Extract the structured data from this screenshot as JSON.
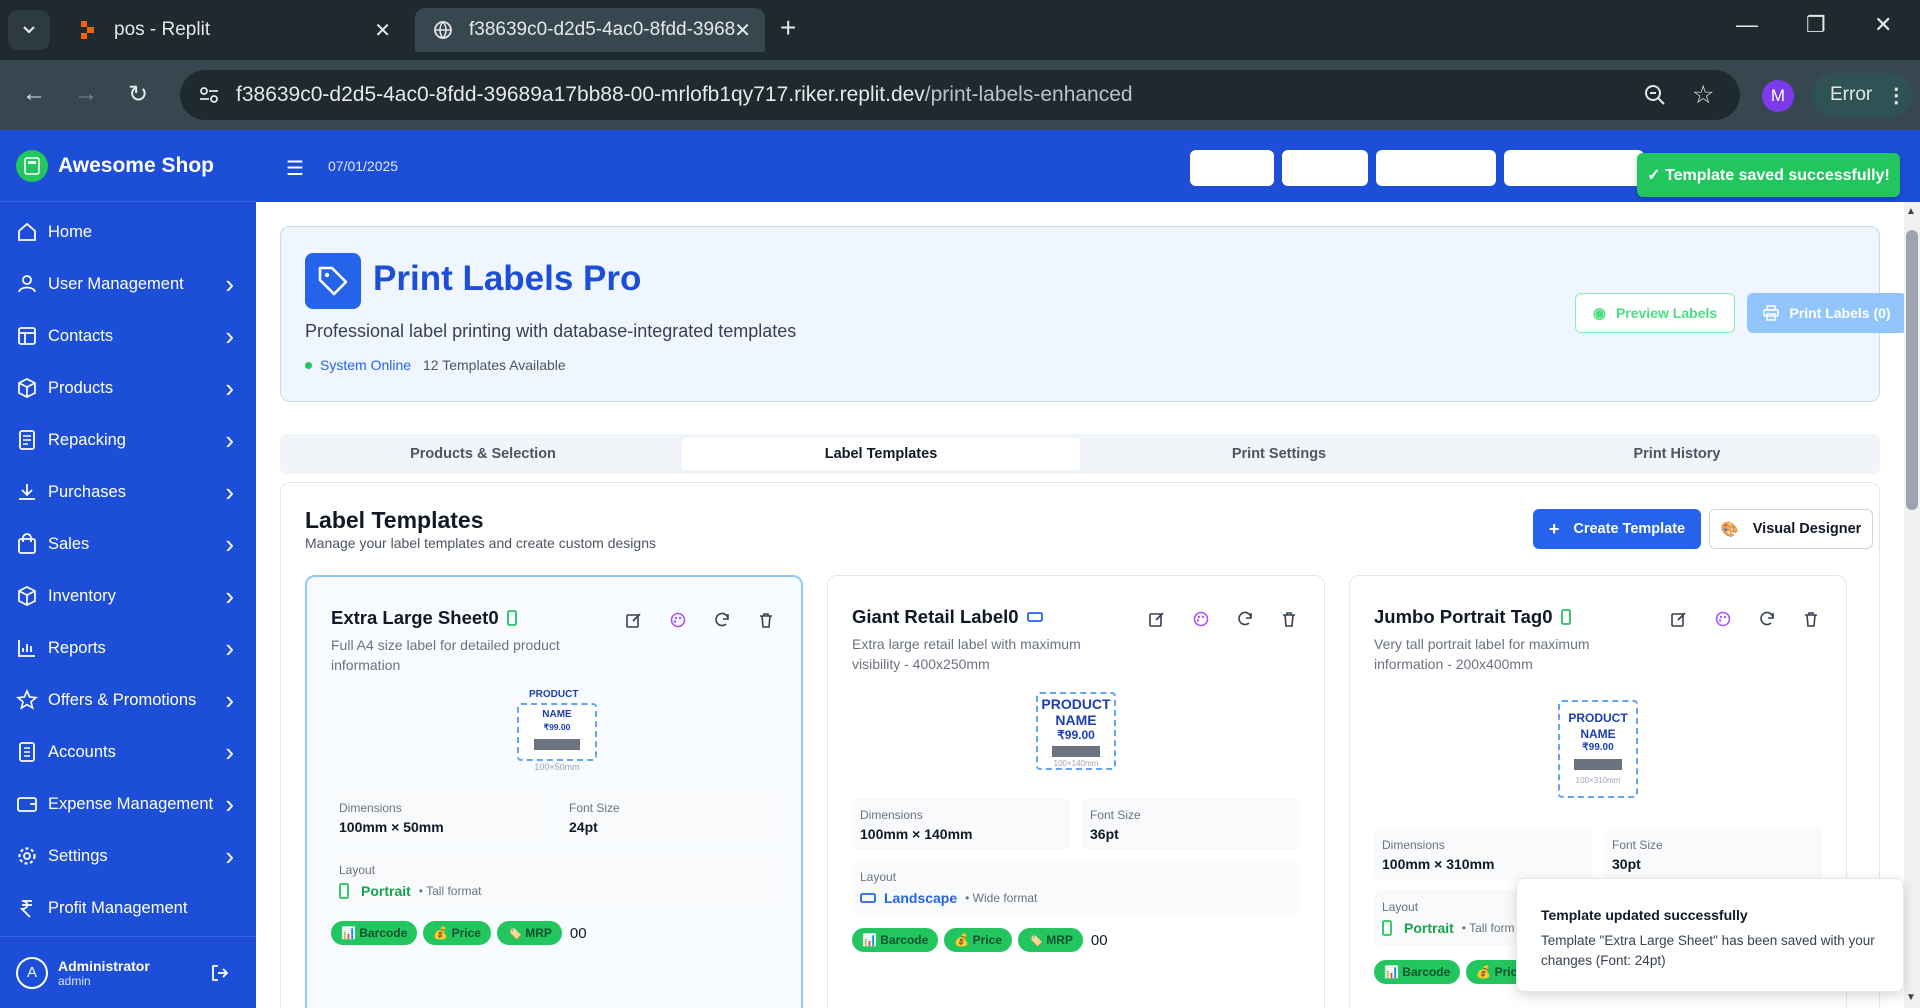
{
  "browser": {
    "tabs": [
      {
        "title": "pos - Replit"
      },
      {
        "title": "f38639c0-d2d5-4ac0-8fdd-3968"
      }
    ],
    "url_main": "f38639c0-d2d5-4ac0-8fdd-39689a17bb88-00-mrlofb1qy717.riker.replit.dev",
    "url_path": "/print-labels-enhanced",
    "profile_initial": "M",
    "error_label": "Error"
  },
  "app": {
    "brand": "Awesome Shop",
    "date": "07/01/2025",
    "toast_saved": "✓ Template saved successfully!"
  },
  "sidebar": {
    "items": [
      {
        "label": "Home",
        "icon": "home-icon",
        "chevron": false
      },
      {
        "label": "User Management",
        "icon": "user-icon",
        "chevron": true
      },
      {
        "label": "Contacts",
        "icon": "contacts-icon",
        "chevron": true
      },
      {
        "label": "Products",
        "icon": "box-icon",
        "chevron": true
      },
      {
        "label": "Repacking",
        "icon": "repack-icon",
        "chevron": true
      },
      {
        "label": "Purchases",
        "icon": "download-icon",
        "chevron": true
      },
      {
        "label": "Sales",
        "icon": "bag-icon",
        "chevron": true
      },
      {
        "label": "Inventory",
        "icon": "box-icon",
        "chevron": true
      },
      {
        "label": "Reports",
        "icon": "bar-chart-icon",
        "chevron": true
      },
      {
        "label": "Offers & Promotions",
        "icon": "star-icon",
        "chevron": true
      },
      {
        "label": "Accounts",
        "icon": "ledger-icon",
        "chevron": true
      },
      {
        "label": "Expense Management",
        "icon": "wallet-icon",
        "chevron": true
      },
      {
        "label": "Settings",
        "icon": "gear-icon",
        "chevron": true
      },
      {
        "label": "Profit Management",
        "icon": "rupee-icon",
        "chevron": false
      }
    ],
    "user": {
      "initial": "A",
      "name": "Administrator",
      "role": "admin"
    }
  },
  "hero": {
    "title": "Print Labels Pro",
    "subtitle": "Professional label printing with database-integrated templates",
    "status": "System Online",
    "templates_count": "12 Templates Available",
    "preview_button": "Preview Labels",
    "print_button": "Print Labels (0)"
  },
  "tabs": [
    "Products & Selection",
    "Label Templates",
    "Print Settings",
    "Print History"
  ],
  "active_tab": "Label Templates",
  "panel": {
    "title": "Label Templates",
    "subtitle": "Manage your label templates and create custom designs",
    "create_button": "Create Template",
    "visual_button": "Visual Designer"
  },
  "cards": [
    {
      "name": "Extra Large Sheet0",
      "description": "Full A4 size label for detailed product information",
      "preview": {
        "line1": "PRODUCT",
        "line2": "NAME",
        "price": "₹99.00",
        "size": "100×50mm"
      },
      "dimensions_label": "Dimensions",
      "dimensions": "100mm × 50mm",
      "font_label": "Font Size",
      "font": "24pt",
      "layout_label": "Layout",
      "layout": "Portrait",
      "layout_note": "• Tall format",
      "badges": [
        "📊 Barcode",
        "💰 Price",
        "🏷️ MRP"
      ],
      "suffix": "00"
    },
    {
      "name": "Giant Retail Label0",
      "description": "Extra large retail label with maximum visibility - 400x250mm",
      "preview": {
        "line1": "PRODUCT",
        "line2": "NAME",
        "price": "₹99.00",
        "size": "100×140mm"
      },
      "dimensions_label": "Dimensions",
      "dimensions": "100mm × 140mm",
      "font_label": "Font Size",
      "font": "36pt",
      "layout_label": "Layout",
      "layout": "Landscape",
      "layout_note": "• Wide format",
      "badges": [
        "📊 Barcode",
        "💰 Price",
        "🏷️ MRP"
      ],
      "suffix": "00"
    },
    {
      "name": "Jumbo Portrait Tag0",
      "description": "Very tall portrait label for maximum information - 200x400mm",
      "preview": {
        "line1": "PRODUCT",
        "line2": "NAME",
        "price": "₹99.00",
        "size": "100×310mm"
      },
      "dimensions_label": "Dimensions",
      "dimensions": "100mm × 310mm",
      "font_label": "Font Size",
      "font": "30pt",
      "layout_label": "Layout",
      "layout": "Portrait",
      "layout_note": "• Tall form",
      "badges": [
        "📊 Barcode",
        "💰 Pric"
      ],
      "suffix": ""
    }
  ],
  "toast": {
    "title": "Template updated successfully",
    "message": "Template \"Extra Large Sheet\" has been saved with your changes (Font: 24pt)"
  },
  "colors": {
    "primary": "#1d4ed8",
    "accent": "#2563eb",
    "success": "#22c55e"
  }
}
